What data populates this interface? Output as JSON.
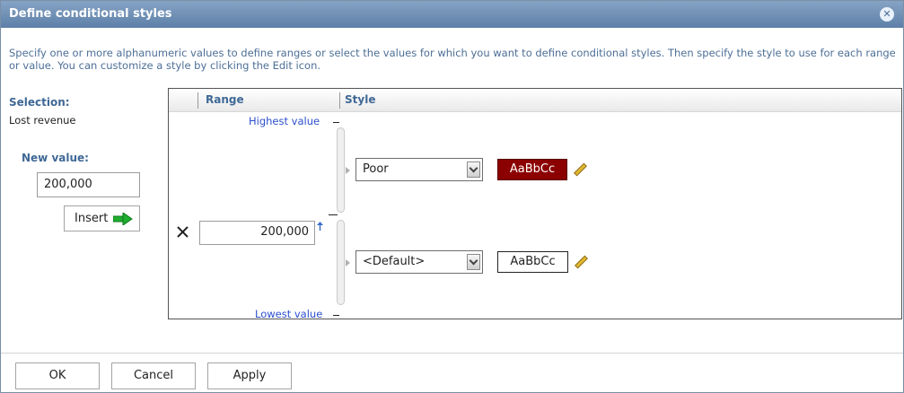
{
  "dialog": {
    "title": "Define conditional styles",
    "close_symbol": "✖",
    "description": "Specify one or more alphanumeric values to define ranges or select the values for which you want to define conditional styles. Then specify the style to use for each range or value. You can customize a style by clicking the Edit icon."
  },
  "left": {
    "selection_label": "Selection:",
    "selection_value": "Lost revenue",
    "new_value_label": "New value:",
    "new_value": "200,000",
    "insert_label": "Insert"
  },
  "grid": {
    "range_header": "Range",
    "style_header": "Style",
    "highest_label": "Highest value",
    "lowest_label": "Lowest value",
    "boundary_value": "200,000",
    "rows": [
      {
        "style_option": "Poor",
        "preview_text": "AaBbCc",
        "preview_bg": "#8b0000",
        "preview_fg": "#ffffff"
      },
      {
        "style_option": "<Default>",
        "preview_text": "AaBbCc",
        "preview_bg": "#ffffff",
        "preview_fg": "#222222"
      }
    ]
  },
  "buttons": {
    "ok": "OK",
    "cancel": "Cancel",
    "apply": "Apply"
  },
  "colors": {
    "title_bar": "#6f8db3",
    "label_blue": "#3f6896",
    "link_blue": "#2c4fcf",
    "insert_arrow": "#1fae2f",
    "poor_swatch": "#8b0000"
  },
  "icons": [
    "close-icon",
    "insert-arrow-icon",
    "delete-x-icon",
    "sort-up-icon",
    "chevron-down-icon",
    "pencil-icon"
  ]
}
